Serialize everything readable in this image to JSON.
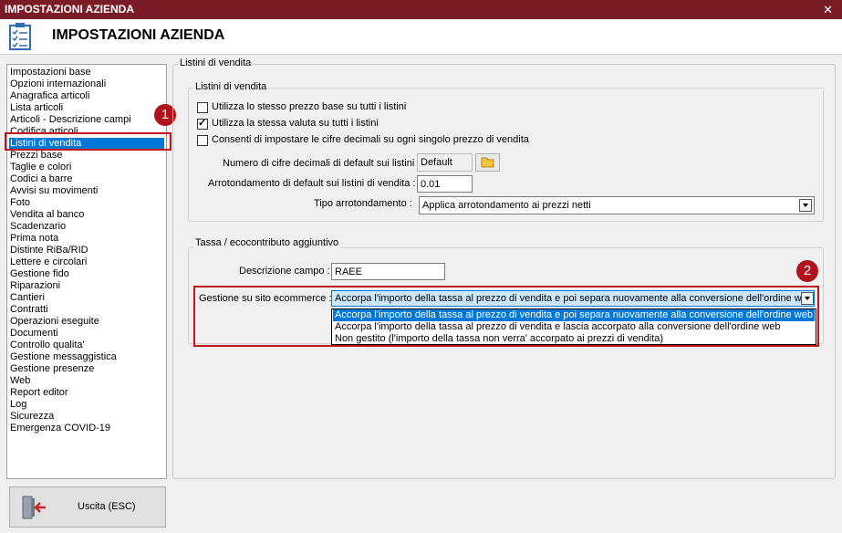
{
  "window": {
    "title": "IMPOSTAZIONI AZIENDA",
    "close_label": "✕"
  },
  "header": {
    "title": "IMPOSTAZIONI AZIENDA",
    "icon": "checklist-icon"
  },
  "nav": {
    "items": [
      "Impostazioni base",
      "Opzioni internazionali",
      "Anagrafica articoli",
      "Lista articoli",
      "Articoli - Descrizione campi",
      "Codifica articoli",
      "Listini di vendita",
      "Prezzi base",
      "Taglie e colori",
      "Codici a barre",
      "Avvisi su movimenti",
      "Foto",
      "Vendita al banco",
      "Scadenzario",
      "Prima nota",
      "Distinte RiBa/RID",
      "Lettere e circolari",
      "Gestione fido",
      "Riparazioni",
      "Cantieri",
      "Contratti",
      "Operazioni eseguite",
      "Documenti",
      "Controllo qualita'",
      "Gestione messaggistica",
      "Gestione presenze",
      "Web",
      "Report editor",
      "Log",
      "Sicurezza",
      "Emergenza COVID-19"
    ],
    "selected_index": 6
  },
  "exit_button": {
    "label": "Uscita (ESC)",
    "icon": "exit-door-icon"
  },
  "badges": {
    "one": "1",
    "two": "2"
  },
  "main": {
    "outer_group_title": "Listini di vendita",
    "pricing": {
      "title": "Listini di vendita",
      "check_same_base": {
        "label": "Utilizza lo stesso prezzo base su tutti i listini",
        "checked": false
      },
      "check_same_currency": {
        "label": "Utilizza la stessa valuta su tutti i listini",
        "checked": true
      },
      "check_decimals": {
        "label": "Consenti di impostare le cifre decimali su ogni singolo prezzo di vendita",
        "checked": false
      },
      "decimals_label": "Numero di cifre decimali di default sui listini :",
      "decimals_value": "Default",
      "rounding_label": "Arrotondamento di default sui listini di vendita :",
      "rounding_value": "0.01",
      "rounding_type_label": "Tipo arrotondamento :",
      "rounding_type_value": "Applica arrotondamento ai prezzi netti"
    },
    "tax": {
      "title": "Tassa / ecocontributo aggiuntivo",
      "description_label": "Descrizione campo :",
      "description_value": "RAEE",
      "ecommerce_label": "Gestione su sito ecommerce :",
      "ecommerce_value": "Accorpa l'importo della tassa al prezzo di vendita e poi separa nuovamente alla conversione dell'ordine web",
      "ecommerce_options": [
        "Accorpa l'importo della tassa al prezzo di vendita e poi separa nuovamente alla conversione dell'ordine web",
        "Accorpa l'importo della tassa al prezzo di vendita e lascia accorpato alla conversione dell'ordine web",
        "Non gestito (l'importo della tassa non verra' accorpato ai prezzi di vendita)"
      ]
    }
  },
  "colors": {
    "titlebar": "#7a1c25",
    "selection": "#0078d7",
    "highlight_box": "#c0141d"
  }
}
